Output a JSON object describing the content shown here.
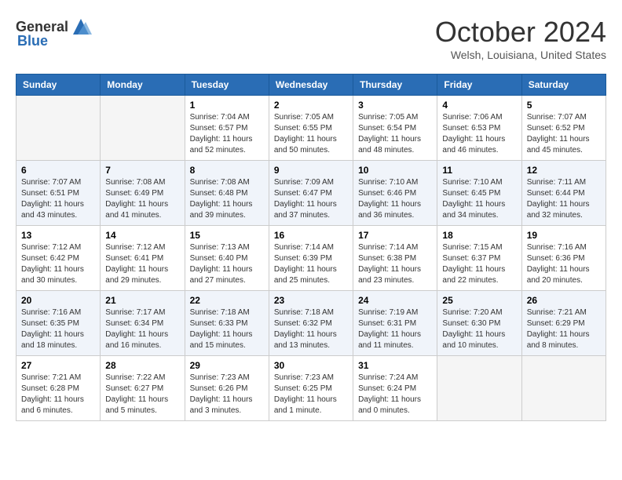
{
  "header": {
    "logo_general": "General",
    "logo_blue": "Blue",
    "month_title": "October 2024",
    "location": "Welsh, Louisiana, United States"
  },
  "days_of_week": [
    "Sunday",
    "Monday",
    "Tuesday",
    "Wednesday",
    "Thursday",
    "Friday",
    "Saturday"
  ],
  "weeks": [
    [
      {
        "day": "",
        "sunrise": "",
        "sunset": "",
        "daylight": "",
        "empty": true
      },
      {
        "day": "",
        "sunrise": "",
        "sunset": "",
        "daylight": "",
        "empty": true
      },
      {
        "day": "1",
        "sunrise": "Sunrise: 7:04 AM",
        "sunset": "Sunset: 6:57 PM",
        "daylight": "Daylight: 11 hours and 52 minutes."
      },
      {
        "day": "2",
        "sunrise": "Sunrise: 7:05 AM",
        "sunset": "Sunset: 6:55 PM",
        "daylight": "Daylight: 11 hours and 50 minutes."
      },
      {
        "day": "3",
        "sunrise": "Sunrise: 7:05 AM",
        "sunset": "Sunset: 6:54 PM",
        "daylight": "Daylight: 11 hours and 48 minutes."
      },
      {
        "day": "4",
        "sunrise": "Sunrise: 7:06 AM",
        "sunset": "Sunset: 6:53 PM",
        "daylight": "Daylight: 11 hours and 46 minutes."
      },
      {
        "day": "5",
        "sunrise": "Sunrise: 7:07 AM",
        "sunset": "Sunset: 6:52 PM",
        "daylight": "Daylight: 11 hours and 45 minutes."
      }
    ],
    [
      {
        "day": "6",
        "sunrise": "Sunrise: 7:07 AM",
        "sunset": "Sunset: 6:51 PM",
        "daylight": "Daylight: 11 hours and 43 minutes."
      },
      {
        "day": "7",
        "sunrise": "Sunrise: 7:08 AM",
        "sunset": "Sunset: 6:49 PM",
        "daylight": "Daylight: 11 hours and 41 minutes."
      },
      {
        "day": "8",
        "sunrise": "Sunrise: 7:08 AM",
        "sunset": "Sunset: 6:48 PM",
        "daylight": "Daylight: 11 hours and 39 minutes."
      },
      {
        "day": "9",
        "sunrise": "Sunrise: 7:09 AM",
        "sunset": "Sunset: 6:47 PM",
        "daylight": "Daylight: 11 hours and 37 minutes."
      },
      {
        "day": "10",
        "sunrise": "Sunrise: 7:10 AM",
        "sunset": "Sunset: 6:46 PM",
        "daylight": "Daylight: 11 hours and 36 minutes."
      },
      {
        "day": "11",
        "sunrise": "Sunrise: 7:10 AM",
        "sunset": "Sunset: 6:45 PM",
        "daylight": "Daylight: 11 hours and 34 minutes."
      },
      {
        "day": "12",
        "sunrise": "Sunrise: 7:11 AM",
        "sunset": "Sunset: 6:44 PM",
        "daylight": "Daylight: 11 hours and 32 minutes."
      }
    ],
    [
      {
        "day": "13",
        "sunrise": "Sunrise: 7:12 AM",
        "sunset": "Sunset: 6:42 PM",
        "daylight": "Daylight: 11 hours and 30 minutes."
      },
      {
        "day": "14",
        "sunrise": "Sunrise: 7:12 AM",
        "sunset": "Sunset: 6:41 PM",
        "daylight": "Daylight: 11 hours and 29 minutes."
      },
      {
        "day": "15",
        "sunrise": "Sunrise: 7:13 AM",
        "sunset": "Sunset: 6:40 PM",
        "daylight": "Daylight: 11 hours and 27 minutes."
      },
      {
        "day": "16",
        "sunrise": "Sunrise: 7:14 AM",
        "sunset": "Sunset: 6:39 PM",
        "daylight": "Daylight: 11 hours and 25 minutes."
      },
      {
        "day": "17",
        "sunrise": "Sunrise: 7:14 AM",
        "sunset": "Sunset: 6:38 PM",
        "daylight": "Daylight: 11 hours and 23 minutes."
      },
      {
        "day": "18",
        "sunrise": "Sunrise: 7:15 AM",
        "sunset": "Sunset: 6:37 PM",
        "daylight": "Daylight: 11 hours and 22 minutes."
      },
      {
        "day": "19",
        "sunrise": "Sunrise: 7:16 AM",
        "sunset": "Sunset: 6:36 PM",
        "daylight": "Daylight: 11 hours and 20 minutes."
      }
    ],
    [
      {
        "day": "20",
        "sunrise": "Sunrise: 7:16 AM",
        "sunset": "Sunset: 6:35 PM",
        "daylight": "Daylight: 11 hours and 18 minutes."
      },
      {
        "day": "21",
        "sunrise": "Sunrise: 7:17 AM",
        "sunset": "Sunset: 6:34 PM",
        "daylight": "Daylight: 11 hours and 16 minutes."
      },
      {
        "day": "22",
        "sunrise": "Sunrise: 7:18 AM",
        "sunset": "Sunset: 6:33 PM",
        "daylight": "Daylight: 11 hours and 15 minutes."
      },
      {
        "day": "23",
        "sunrise": "Sunrise: 7:18 AM",
        "sunset": "Sunset: 6:32 PM",
        "daylight": "Daylight: 11 hours and 13 minutes."
      },
      {
        "day": "24",
        "sunrise": "Sunrise: 7:19 AM",
        "sunset": "Sunset: 6:31 PM",
        "daylight": "Daylight: 11 hours and 11 minutes."
      },
      {
        "day": "25",
        "sunrise": "Sunrise: 7:20 AM",
        "sunset": "Sunset: 6:30 PM",
        "daylight": "Daylight: 11 hours and 10 minutes."
      },
      {
        "day": "26",
        "sunrise": "Sunrise: 7:21 AM",
        "sunset": "Sunset: 6:29 PM",
        "daylight": "Daylight: 11 hours and 8 minutes."
      }
    ],
    [
      {
        "day": "27",
        "sunrise": "Sunrise: 7:21 AM",
        "sunset": "Sunset: 6:28 PM",
        "daylight": "Daylight: 11 hours and 6 minutes."
      },
      {
        "day": "28",
        "sunrise": "Sunrise: 7:22 AM",
        "sunset": "Sunset: 6:27 PM",
        "daylight": "Daylight: 11 hours and 5 minutes."
      },
      {
        "day": "29",
        "sunrise": "Sunrise: 7:23 AM",
        "sunset": "Sunset: 6:26 PM",
        "daylight": "Daylight: 11 hours and 3 minutes."
      },
      {
        "day": "30",
        "sunrise": "Sunrise: 7:23 AM",
        "sunset": "Sunset: 6:25 PM",
        "daylight": "Daylight: 11 hours and 1 minute."
      },
      {
        "day": "31",
        "sunrise": "Sunrise: 7:24 AM",
        "sunset": "Sunset: 6:24 PM",
        "daylight": "Daylight: 11 hours and 0 minutes."
      },
      {
        "day": "",
        "sunrise": "",
        "sunset": "",
        "daylight": "",
        "empty": true
      },
      {
        "day": "",
        "sunrise": "",
        "sunset": "",
        "daylight": "",
        "empty": true
      }
    ]
  ]
}
